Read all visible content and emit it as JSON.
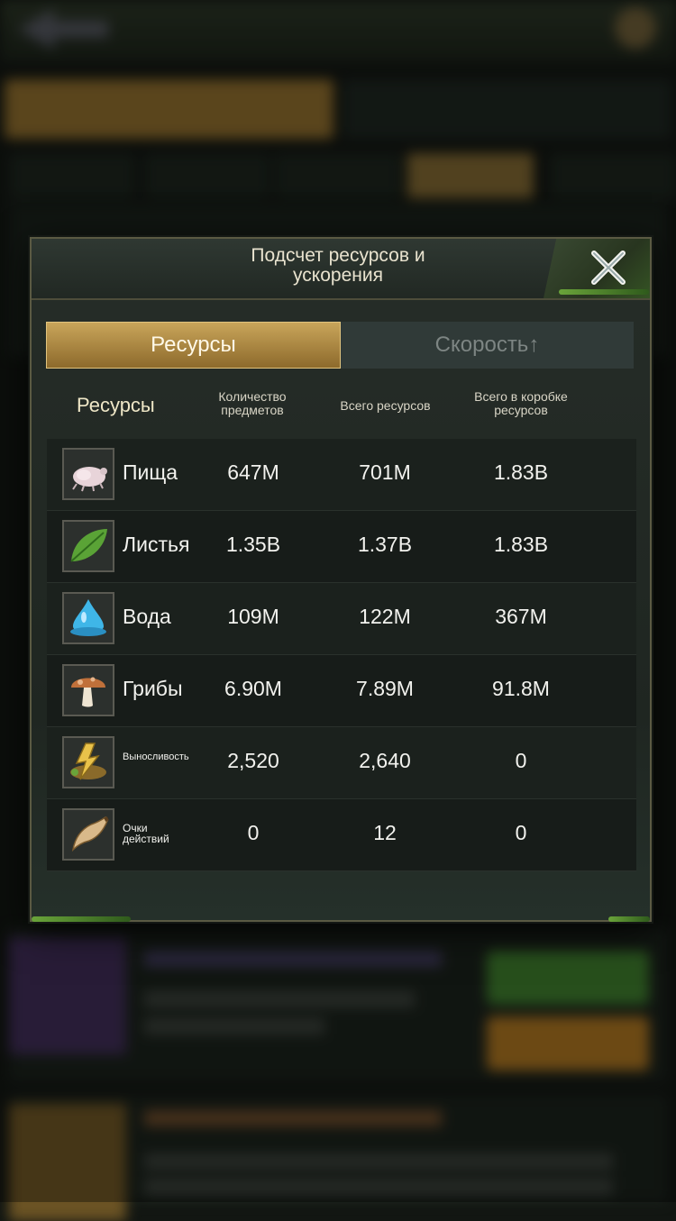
{
  "modal": {
    "title_line1": "Подсчет ресурсов и",
    "title_line2": "ускорения",
    "tabs": [
      {
        "label": "Ресурсы",
        "active": true
      },
      {
        "label": "Скорость↑",
        "active": false
      }
    ]
  },
  "table": {
    "headers": {
      "resource": "Ресурсы",
      "count_line1": "Количество",
      "count_line2": "предметов",
      "total": "Всего ресурсов",
      "box_line1": "Всего в коробке",
      "box_line2": "ресурсов"
    },
    "rows": [
      {
        "icon": "food-icon",
        "name": "Пища",
        "count": "647M",
        "total": "701M",
        "box": "1.83B"
      },
      {
        "icon": "leaf-icon",
        "name": "Листья",
        "count": "1.35B",
        "total": "1.37B",
        "box": "1.83B"
      },
      {
        "icon": "water-drop-icon",
        "name": "Вода",
        "count": "109M",
        "total": "122M",
        "box": "367M"
      },
      {
        "icon": "mushroom-icon",
        "name": "Грибы",
        "count": "6.90M",
        "total": "7.89M",
        "box": "91.8M"
      },
      {
        "icon": "stamina-icon",
        "name": "Выносливость",
        "count": "2,520",
        "total": "2,640",
        "box": "0"
      },
      {
        "icon": "horn-icon",
        "name_line1": "Очки",
        "name_line2": "действий",
        "count": "0",
        "total": "12",
        "box": "0"
      }
    ]
  },
  "colors": {
    "accent_gold": "#c9a55a",
    "panel_bg": "#1f2621"
  }
}
